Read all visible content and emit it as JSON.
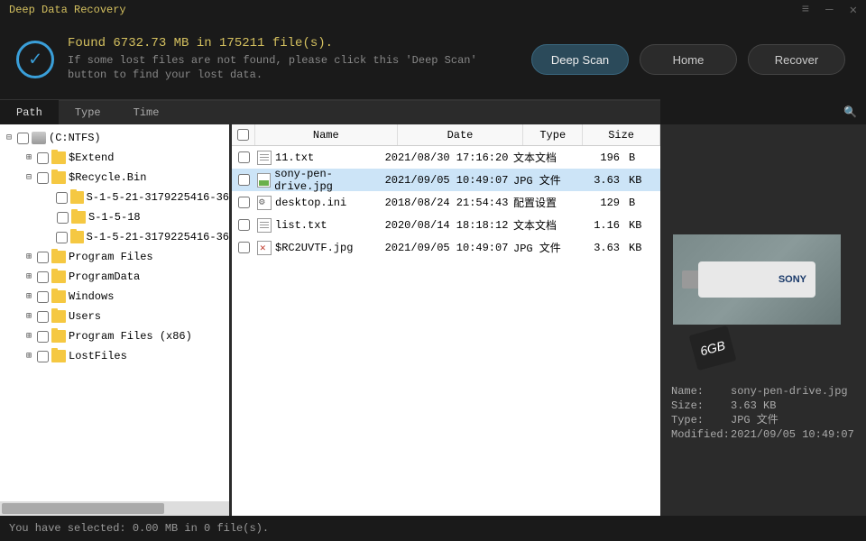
{
  "app_title": "Deep Data Recovery",
  "header": {
    "title": "Found 6732.73 MB in 175211 file(s).",
    "subtitle": "If some lost files are not found, please click this 'Deep Scan' button to find your lost data.",
    "deep_scan": "Deep Scan",
    "home": "Home",
    "recover": "Recover"
  },
  "tabs": {
    "path": "Path",
    "type": "Type",
    "time": "Time"
  },
  "tree": [
    {
      "indent": 0,
      "toggle": "−",
      "icon": "drive",
      "label": "(C:NTFS)"
    },
    {
      "indent": 1,
      "toggle": "+",
      "icon": "folder",
      "label": "$Extend"
    },
    {
      "indent": 1,
      "toggle": "−",
      "icon": "folder",
      "label": "$Recycle.Bin"
    },
    {
      "indent": 2,
      "toggle": "",
      "icon": "folder",
      "label": "S-1-5-21-3179225416-36"
    },
    {
      "indent": 2,
      "toggle": "",
      "icon": "folder",
      "label": "S-1-5-18"
    },
    {
      "indent": 2,
      "toggle": "",
      "icon": "folder",
      "label": "S-1-5-21-3179225416-36"
    },
    {
      "indent": 1,
      "toggle": "+",
      "icon": "folder",
      "label": "Program Files"
    },
    {
      "indent": 1,
      "toggle": "+",
      "icon": "folder",
      "label": "ProgramData"
    },
    {
      "indent": 1,
      "toggle": "+",
      "icon": "folder",
      "label": "Windows"
    },
    {
      "indent": 1,
      "toggle": "+",
      "icon": "folder",
      "label": "Users"
    },
    {
      "indent": 1,
      "toggle": "+",
      "icon": "folder",
      "label": "Program Files (x86)"
    },
    {
      "indent": 1,
      "toggle": "+",
      "icon": "folder",
      "label": "LostFiles"
    }
  ],
  "file_columns": {
    "name": "Name",
    "date": "Date",
    "type": "Type",
    "size": "Size"
  },
  "files": [
    {
      "name": "11.txt",
      "date": "2021/08/30 17:16:20",
      "type": "文本文档",
      "size": "196",
      "unit": "B",
      "icon": "doc",
      "selected": false
    },
    {
      "name": "sony-pen-drive.jpg",
      "date": "2021/09/05 10:49:07",
      "type": "JPG 文件",
      "size": "3.63",
      "unit": "KB",
      "icon": "img",
      "selected": true
    },
    {
      "name": "desktop.ini",
      "date": "2018/08/24 21:54:43",
      "type": "配置设置",
      "size": "129",
      "unit": "B",
      "icon": "ini",
      "selected": false
    },
    {
      "name": "list.txt",
      "date": "2020/08/14 18:18:12",
      "type": "文本文档",
      "size": "1.16",
      "unit": "KB",
      "icon": "doc",
      "selected": false
    },
    {
      "name": "$RC2UVTF.jpg",
      "date": "2021/09/05 10:49:07",
      "type": "JPG 文件",
      "size": "3.63",
      "unit": "KB",
      "icon": "broken",
      "selected": false
    }
  ],
  "thumb": {
    "cap": "6GB",
    "brand": "SONY"
  },
  "info": {
    "name_label": "Name:",
    "name_value": "sony-pen-drive.jpg",
    "size_label": "Size:",
    "size_value": "3.63 KB",
    "type_label": "Type:",
    "type_value": "JPG 文件",
    "modified_label": "Modified:",
    "modified_value": "2021/09/05 10:49:07"
  },
  "status": "You have selected: 0.00 MB in 0 file(s).",
  "search_placeholder": ""
}
